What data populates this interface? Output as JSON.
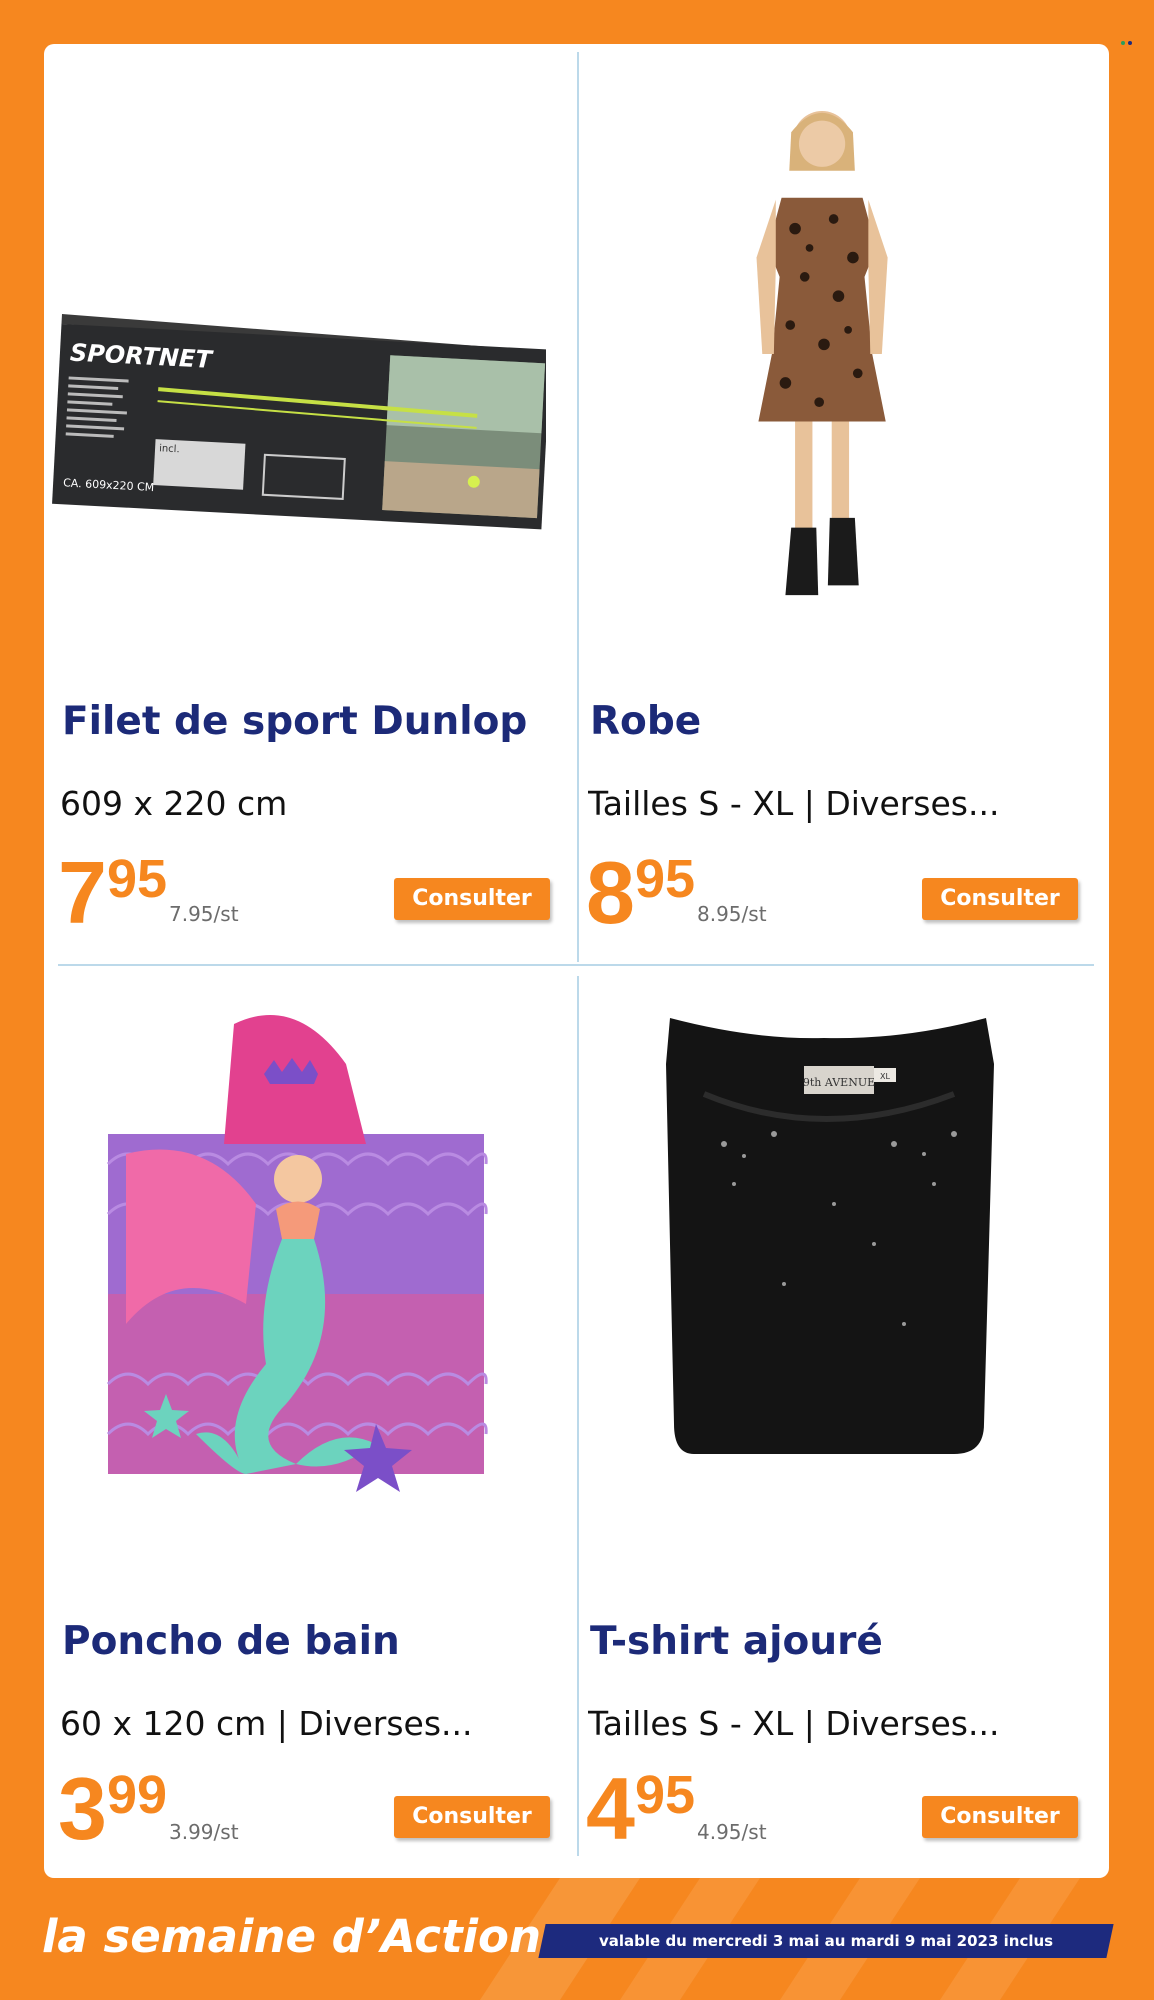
{
  "products": [
    {
      "title": "Filet de sport Dunlop",
      "description": "609 x 220 cm",
      "price_int": "7",
      "price_dec": "95",
      "unit_price": "7.95/st",
      "button": "Consulter",
      "image": {
        "brand": "SPORTNET",
        "size": "CA. 609x220 CM",
        "incl": "incl."
      }
    },
    {
      "title": "Robe",
      "description": "Tailles S - XL | Diverses...",
      "price_int": "8",
      "price_dec": "95",
      "unit_price": "8.95/st",
      "button": "Consulter"
    },
    {
      "title": "Poncho de bain",
      "description": "60 x 120 cm | Diverses...",
      "price_int": "3",
      "price_dec": "99",
      "unit_price": "3.99/st",
      "button": "Consulter"
    },
    {
      "title": "T-shirt ajouré",
      "description": "Tailles S - XL | Diverses...",
      "price_int": "4",
      "price_dec": "95",
      "unit_price": "4.95/st",
      "button": "Consulter",
      "image": {
        "label": "9th AVENUE",
        "size": "XL"
      }
    }
  ],
  "footer": {
    "tagline": "la semaine d’Action",
    "validity": "valable du mercredi 3 mai au mardi 9 mai 2023 inclus"
  },
  "colors": {
    "accent": "#f6871f",
    "title": "#1c2a78",
    "divider": "#bcd9ea",
    "validity_bg": "#1d2a7e"
  }
}
